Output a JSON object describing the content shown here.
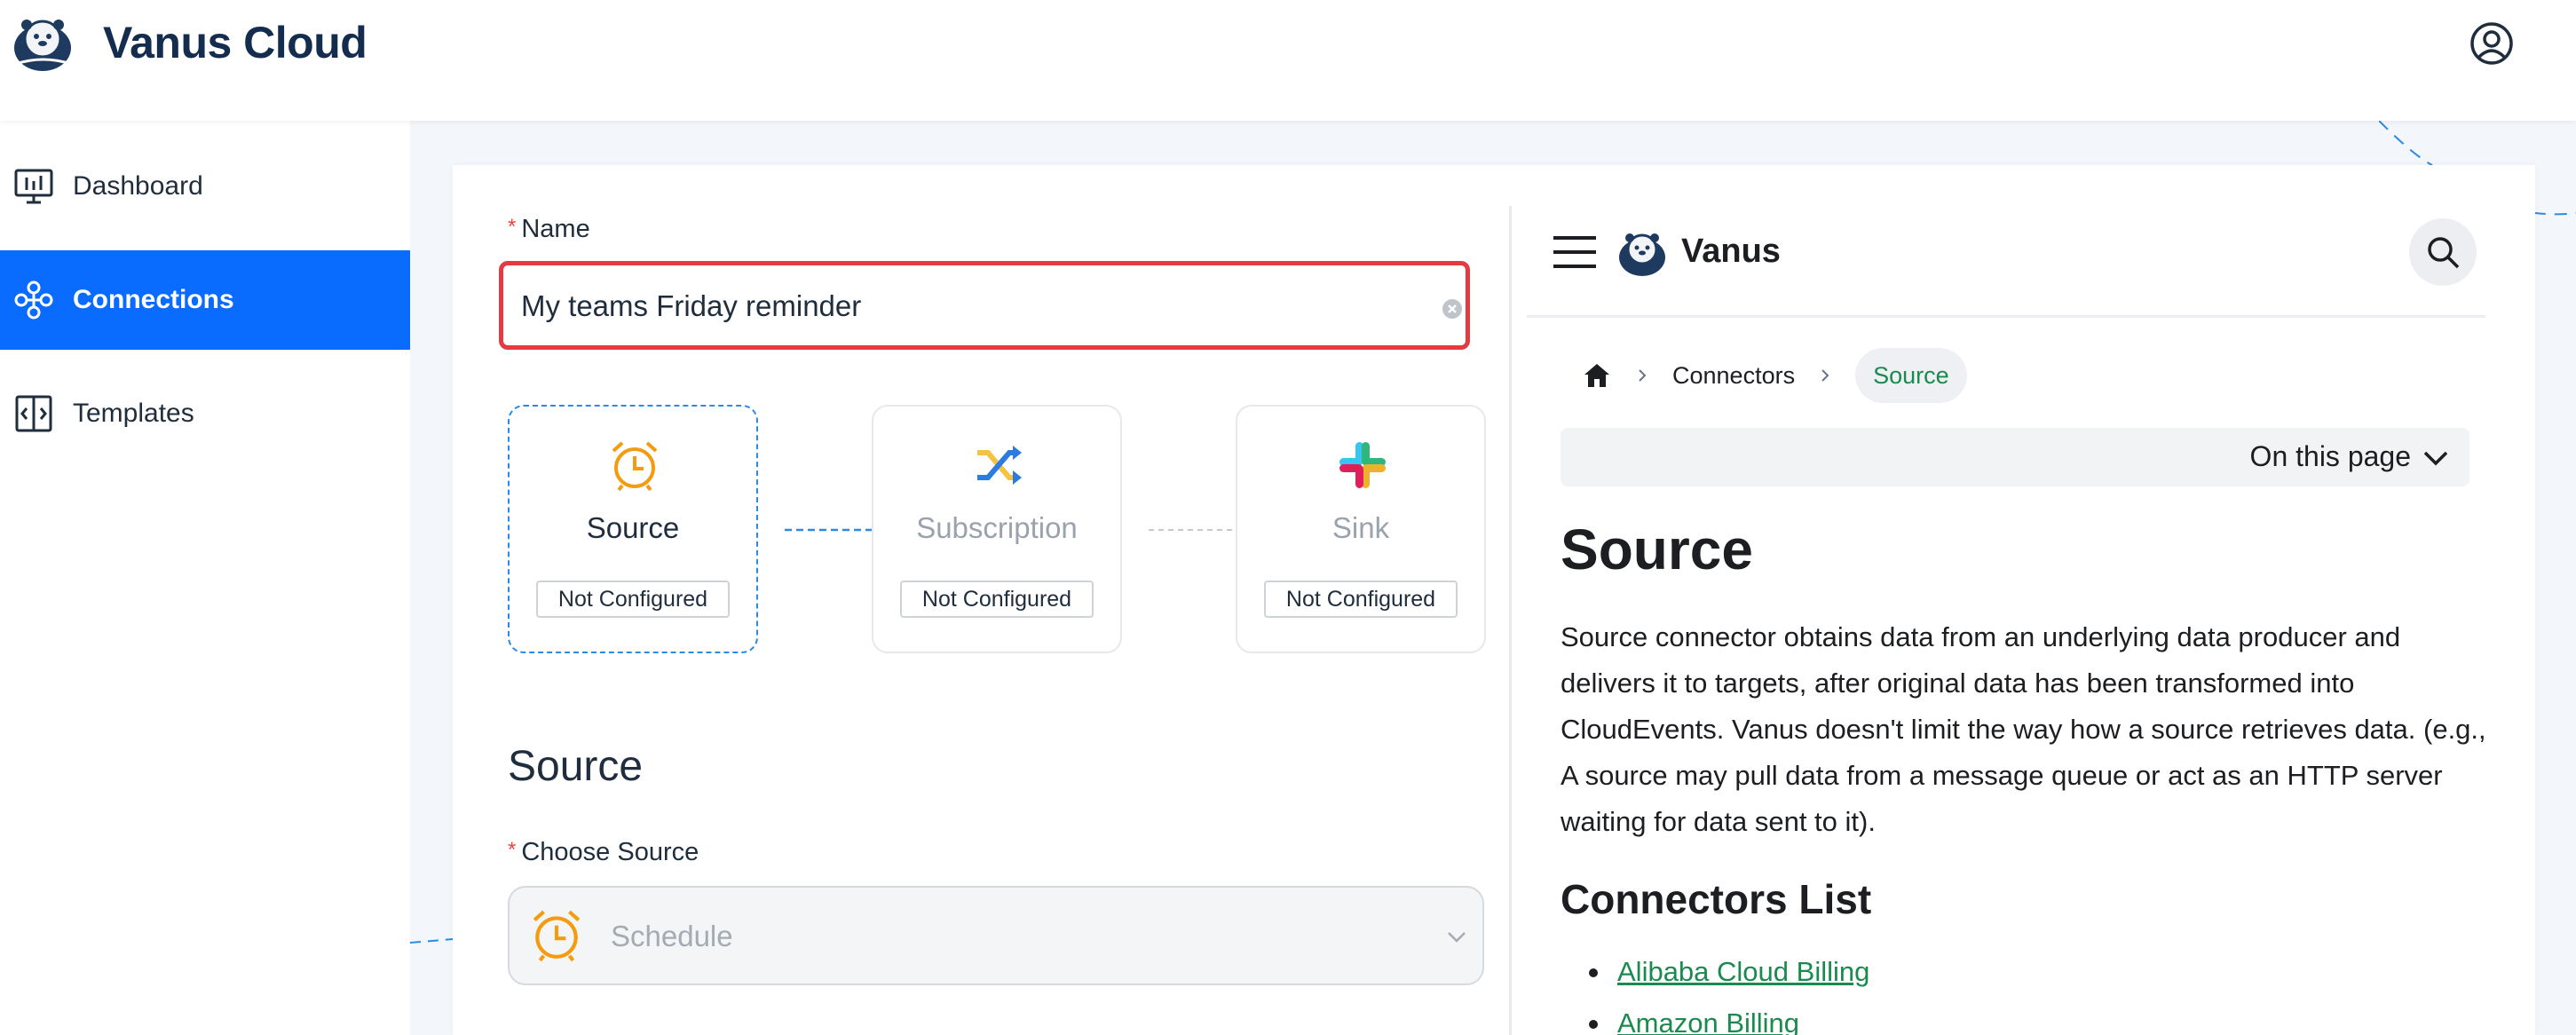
{
  "header": {
    "app_title": "Vanus Cloud"
  },
  "sidebar": {
    "items": [
      {
        "label": "Dashboard",
        "icon": "dashboard-icon",
        "active": false
      },
      {
        "label": "Connections",
        "icon": "connections-icon",
        "active": true
      },
      {
        "label": "Templates",
        "icon": "templates-icon",
        "active": false
      }
    ]
  },
  "form": {
    "name_label": "Name",
    "name_value": "My teams Friday reminder",
    "steps": [
      {
        "title": "Source",
        "status": "Not Configured",
        "icon": "alarm-clock-icon"
      },
      {
        "title": "Subscription",
        "status": "Not Configured",
        "icon": "shuffle-icon"
      },
      {
        "title": "Sink",
        "status": "Not Configured",
        "icon": "slack-icon"
      }
    ],
    "section_title": "Source",
    "choose_source_label": "Choose Source",
    "choose_source_value": "Schedule"
  },
  "docs": {
    "brand": "Vanus",
    "breadcrumb": {
      "items": [
        "Connectors"
      ],
      "active": "Source"
    },
    "toc_label": "On this page",
    "heading": "Source",
    "paragraph": "Source connector obtains data from an underlying data producer and delivers it to targets, after original data has been transformed into CloudEvents. Vanus doesn't limit the way how a source retrieves data. (e.g., A source may pull data from a message queue or act as an HTTP server waiting for data sent to it).",
    "list_heading": "Connectors List",
    "list_items": [
      "Alibaba Cloud Billing",
      "Amazon Billing"
    ]
  },
  "colors": {
    "primary": "#0a6cff",
    "highlight": "#e33b44",
    "link": "#1a8a4f",
    "alarm": "#f39c12"
  }
}
